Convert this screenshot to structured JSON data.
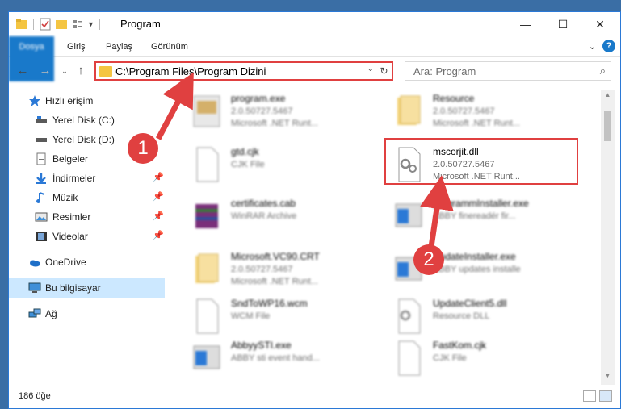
{
  "window": {
    "title": "Program",
    "minimize": "—",
    "maximize": "☐",
    "close": "✕"
  },
  "ribbon": {
    "tabs": [
      "Dosya",
      "Giriş",
      "Paylaş",
      "Görünüm"
    ],
    "help": "?"
  },
  "address": {
    "path": "C:\\Program Files\\Program Dizini",
    "search_placeholder": "Ara: Program"
  },
  "sidebar": {
    "items": [
      {
        "label": "Hızlı erişim",
        "icon": "star-icon"
      },
      {
        "label": "Yerel Disk (C:)",
        "icon": "drive-icon"
      },
      {
        "label": "Yerel Disk (D:)",
        "icon": "drive-icon"
      },
      {
        "label": "Belgeler",
        "icon": "documents-icon"
      },
      {
        "label": "İndirmeler",
        "icon": "download-icon"
      },
      {
        "label": "Müzik",
        "icon": "music-icon"
      },
      {
        "label": "Resimler",
        "icon": "pictures-icon"
      },
      {
        "label": "Videolar",
        "icon": "video-icon"
      },
      {
        "label": "OneDrive",
        "icon": "cloud-icon"
      },
      {
        "label": "Bu bilgisayar",
        "icon": "computer-icon"
      },
      {
        "label": "Ağ",
        "icon": "network-icon"
      }
    ]
  },
  "files": [
    {
      "name": "program.exe",
      "line2": "2.0.50727.5467",
      "line3": "Microsoft .NET Runt..."
    },
    {
      "name": "Resource",
      "line2": "2.0.50727.5467",
      "line3": "Microsoft .NET Runt..."
    },
    {
      "name": "gtd.cjk",
      "line2": "CJK File",
      "line3": ""
    },
    {
      "name": "mscorjit.dll",
      "line2": "2.0.50727.5467",
      "line3": "Microsoft .NET Runt..."
    },
    {
      "name": "certificates.cab",
      "line2": "WinRAR Archive",
      "line3": ""
    },
    {
      "name": "programmInstaller.exe",
      "line2": "ABBY finereadér fir...",
      "line3": ""
    },
    {
      "name": "Microsoft.VC90.CRT",
      "line2": "2.0.50727.5467",
      "line3": "Microsoft .NET Runt..."
    },
    {
      "name": "UpdateInstaller.exe",
      "line2": "ABBY updates installe",
      "line3": ""
    },
    {
      "name": "SndToWP16.wcm",
      "line2": "WCM File",
      "line3": ""
    },
    {
      "name": "UpdateClient5.dll",
      "line2": "Resource DLL",
      "line3": ""
    },
    {
      "name": "AbbyySTI.exe",
      "line2": "ABBY sti event hand...",
      "line3": ""
    },
    {
      "name": "FastKom.cjk",
      "line2": "CJK File",
      "line3": ""
    }
  ],
  "status": {
    "count": "186 öğe"
  },
  "markers": [
    "1",
    "2"
  ],
  "colors": {
    "accent": "#1979ca",
    "highlight": "#e04040",
    "selected": "#cce8ff"
  }
}
